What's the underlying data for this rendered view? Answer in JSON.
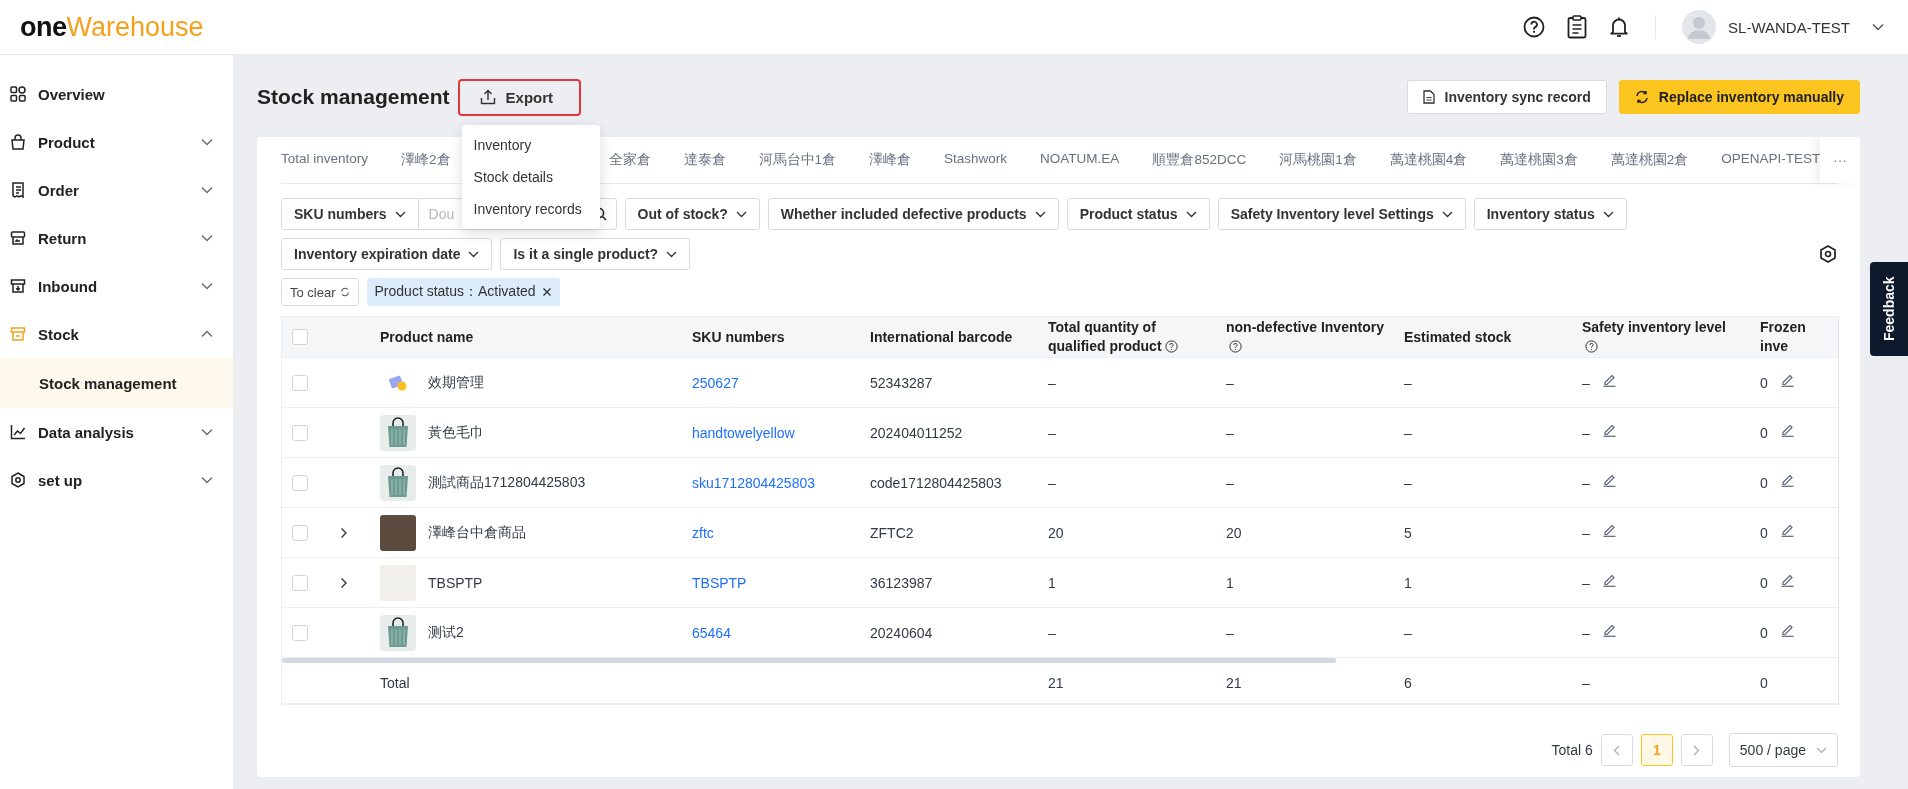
{
  "header": {
    "logo_left": "one",
    "logo_right": "Warehouse",
    "user": "SL-WANDA-TEST"
  },
  "sidebar": {
    "items": [
      {
        "label": "Overview",
        "kind": "link",
        "active": false
      },
      {
        "label": "Product",
        "kind": "group",
        "expanded": false,
        "active": false
      },
      {
        "label": "Order",
        "kind": "group",
        "expanded": false,
        "active": false
      },
      {
        "label": "Return",
        "kind": "group",
        "expanded": false,
        "active": false
      },
      {
        "label": "Inbound",
        "kind": "group",
        "expanded": false,
        "active": false
      },
      {
        "label": "Stock",
        "kind": "group",
        "expanded": true,
        "active": true,
        "children": [
          {
            "label": "Stock management",
            "selected": true
          }
        ]
      },
      {
        "label": "Data analysis",
        "kind": "group",
        "expanded": false,
        "active": false
      },
      {
        "label": "set up",
        "kind": "group",
        "expanded": false,
        "active": false
      }
    ]
  },
  "page": {
    "title": "Stock management",
    "export": {
      "label": "Export",
      "highlighted": true,
      "menu": [
        "Inventory",
        "Stock details",
        "Inventory records"
      ]
    },
    "buttons": [
      {
        "label": "Inventory sync record",
        "kind": "default"
      },
      {
        "label": "Replace inventory manually",
        "kind": "primary"
      }
    ]
  },
  "tabs": [
    "Total inventory",
    "澤峰2倉",
    "全家倉",
    "達泰倉",
    "河馬台中1倉",
    "澤峰倉",
    "Stashwork",
    "NOATUM.EA",
    "順豐倉852DCC",
    "河馬桃園1倉",
    "萬達桃園4倉",
    "萬達桃園3倉",
    "萬達桃園2倉",
    "OPENAPI-TEST"
  ],
  "tabs_more": "···",
  "search": {
    "field": "SKU numbers",
    "placeholder": "Dou"
  },
  "filters": [
    [
      "Out of stock?",
      "Whether included defective products",
      "Product status",
      "Safety Inventory level Settings",
      "Inventory status"
    ],
    [
      "Inventory expiration date",
      "Is it a single product?"
    ]
  ],
  "clear": "To clear",
  "chips": [
    "Product status：Activated"
  ],
  "table": {
    "all_checked": false,
    "columns": [
      {
        "label": "Product name",
        "help": false
      },
      {
        "label": "SKU numbers",
        "help": false
      },
      {
        "label": "International barcode",
        "help": false
      },
      {
        "label": "Total quantity of qualified product",
        "help": true
      },
      {
        "label": "non-defective Inventory",
        "help": true
      },
      {
        "label": "Estimated stock",
        "help": false
      },
      {
        "label": "Safety inventory level",
        "help": true
      },
      {
        "label": "Frozen inve",
        "help": false
      }
    ],
    "rows": [
      {
        "expandable": false,
        "checked": false,
        "name": "效期管理",
        "sku": "250627",
        "barcode": "52343287",
        "total": "–",
        "nondefective": "–",
        "estimated": "–",
        "safety": "–",
        "frozen": "0"
      },
      {
        "expandable": false,
        "checked": false,
        "name": "黃色毛巾",
        "sku": "handtowelyellow",
        "barcode": "202404011252",
        "total": "–",
        "nondefective": "–",
        "estimated": "–",
        "safety": "–",
        "frozen": "0"
      },
      {
        "expandable": false,
        "checked": false,
        "name": "測試商品1712804425803",
        "sku": "sku1712804425803",
        "barcode": "code1712804425803",
        "total": "–",
        "nondefective": "–",
        "estimated": "–",
        "safety": "–",
        "frozen": "0"
      },
      {
        "expandable": true,
        "checked": false,
        "name": "澤峰台中倉商品",
        "sku": "zftc",
        "barcode": "ZFTC2",
        "total": "20",
        "nondefective": "20",
        "estimated": "5",
        "safety": "–",
        "frozen": "0"
      },
      {
        "expandable": true,
        "checked": false,
        "name": "TBSPTP",
        "sku": "TBSPTP",
        "barcode": "36123987",
        "total": "1",
        "nondefective": "1",
        "estimated": "1",
        "safety": "–",
        "frozen": "0"
      },
      {
        "expandable": false,
        "checked": false,
        "name": "测试2",
        "sku": "65464",
        "barcode": "20240604",
        "total": "–",
        "nondefective": "–",
        "estimated": "–",
        "safety": "–",
        "frozen": "0"
      }
    ],
    "total_row": {
      "label": "Total",
      "total": "21",
      "nondefective": "21",
      "estimated": "6",
      "safety": "–",
      "frozen": "0"
    }
  },
  "pagination": {
    "total": "Total 6",
    "pages": [
      {
        "label": "1",
        "selected": true
      }
    ],
    "page_size": "500 / page"
  },
  "feedback": "Feedback"
}
